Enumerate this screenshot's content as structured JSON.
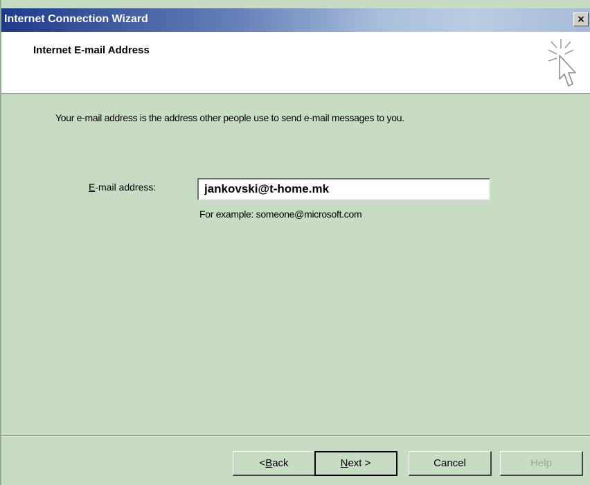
{
  "window": {
    "title": "Internet Connection Wizard",
    "close_glyph": "×"
  },
  "header": {
    "heading": "Internet E-mail Address",
    "icon": "wizard-cursor-icon"
  },
  "content": {
    "intro": "Your e-mail address is the address other people use to send e-mail messages to you.",
    "field_label_accel": "E",
    "field_label_rest": "-mail address:",
    "email_value": "jankovski@t-home.mk",
    "example": "For example: someone@microsoft.com"
  },
  "buttons": {
    "back_prefix": "< ",
    "back_accel": "B",
    "back_rest": "ack",
    "next_accel": "N",
    "next_rest": "ext >",
    "cancel": "Cancel",
    "help": "Help"
  },
  "colors": {
    "body_bg": "#c8dcc4",
    "title_gradient_start": "#1f3a8a",
    "header_bg": "#ffffff"
  }
}
